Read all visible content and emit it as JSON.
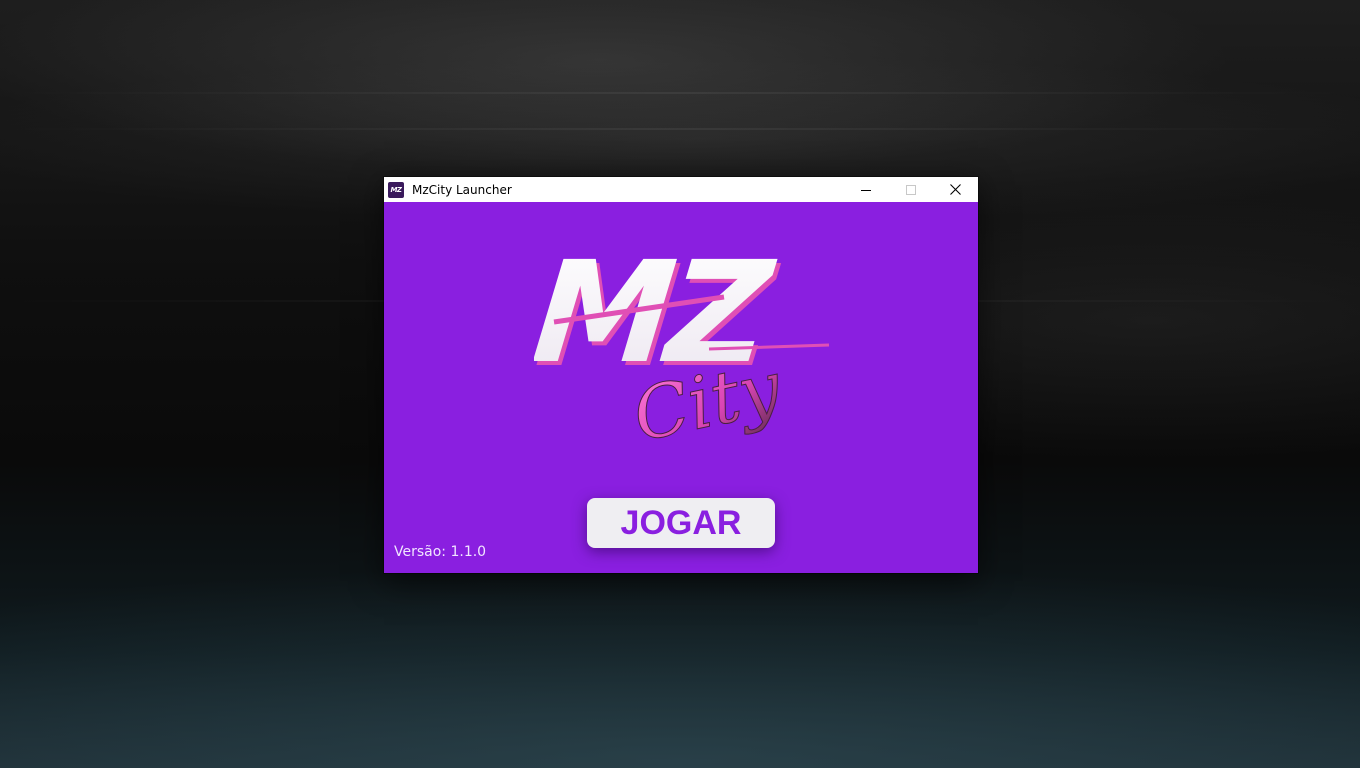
{
  "window": {
    "title": "MzCity Launcher",
    "app_icon_text": "MZ"
  },
  "logo": {
    "top_text": "MZ",
    "script_text": "City"
  },
  "play_button_label": "JOGAR",
  "version_text": "Versão: 1.1.0",
  "colors": {
    "accent": "#8a1fe0",
    "button_bg": "#efeef2",
    "logo_pink": "#e04fb5"
  }
}
